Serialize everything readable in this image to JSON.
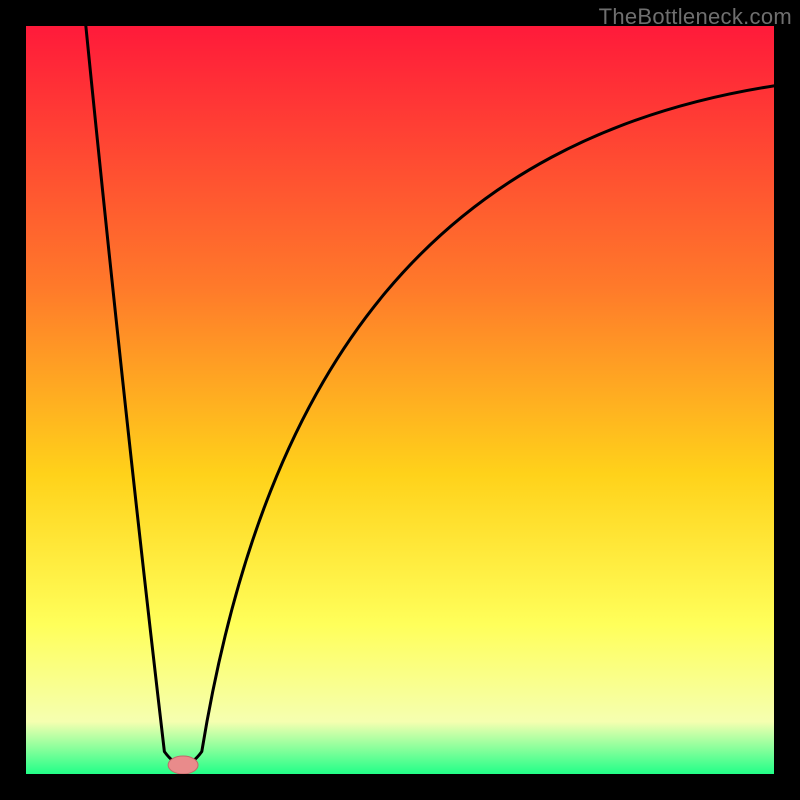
{
  "attribution": "TheBottleneck.com",
  "colors": {
    "frame": "#000000",
    "grad_top": "#ff1a3a",
    "grad_mid1": "#ff7a2a",
    "grad_mid2": "#ffd21a",
    "grad_mid3": "#ffff5a",
    "grad_low": "#f5ffb0",
    "grad_bottom": "#22ff88",
    "curve": "#000000",
    "marker_fill": "#e98b8b",
    "marker_stroke": "#c06a6a"
  },
  "chart_data": {
    "type": "line",
    "title": "",
    "xlabel": "",
    "ylabel": "",
    "xlim": [
      0,
      100
    ],
    "ylim": [
      0,
      100
    ],
    "x_at_min": 20,
    "marker": {
      "x": 21,
      "y": 1.2,
      "rx": 2.0,
      "ry": 1.2
    },
    "left_branch": {
      "x0": 8,
      "y0": 100,
      "x1": 18.5,
      "y1": 3,
      "cx": 13,
      "cy": 50
    },
    "valley": {
      "x0": 18.5,
      "y0": 3,
      "x1": 23.5,
      "y1": 3,
      "cx": 21,
      "cy": -0.5
    },
    "right_branch": {
      "x0": 23.5,
      "y0": 3,
      "c1x": 32,
      "c1y": 55,
      "c2x": 55,
      "c2y": 85,
      "x1": 100,
      "y1": 92
    },
    "gradient_stops": [
      {
        "offset": 0.0,
        "key": "grad_top"
      },
      {
        "offset": 0.35,
        "key": "grad_mid1"
      },
      {
        "offset": 0.6,
        "key": "grad_mid2"
      },
      {
        "offset": 0.8,
        "key": "grad_mid3"
      },
      {
        "offset": 0.93,
        "key": "grad_low"
      },
      {
        "offset": 1.0,
        "key": "grad_bottom"
      }
    ]
  }
}
